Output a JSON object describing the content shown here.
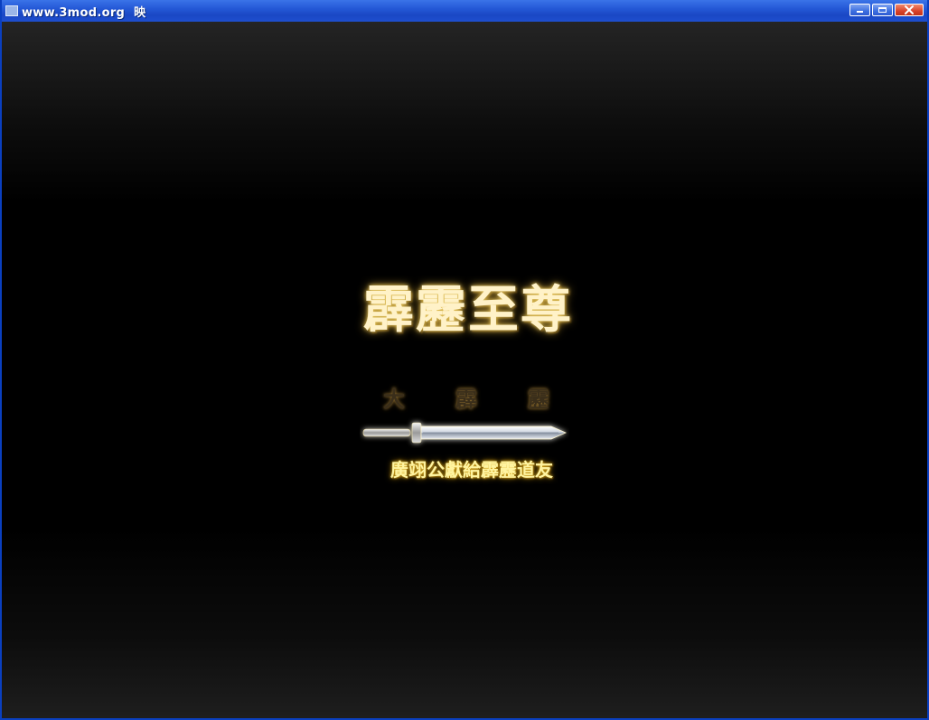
{
  "window": {
    "title_left": "www.3mod.org",
    "title_mid": "映",
    "buttons": {
      "minimize_icon": "minimize-icon",
      "maximize_icon": "maximize-icon",
      "close_icon": "close-icon"
    }
  },
  "splash": {
    "main_title": "霹靂至尊",
    "subtitle": [
      "大",
      "霹",
      "靂"
    ],
    "dedication": "廣翊公獻給霹靂道友",
    "sword_icon": "sword-icon"
  },
  "colors": {
    "titlebar": "#2458d6",
    "background": "#000000",
    "title_gold": "#fff2c8",
    "dedication_gold": "#fff4a0"
  }
}
